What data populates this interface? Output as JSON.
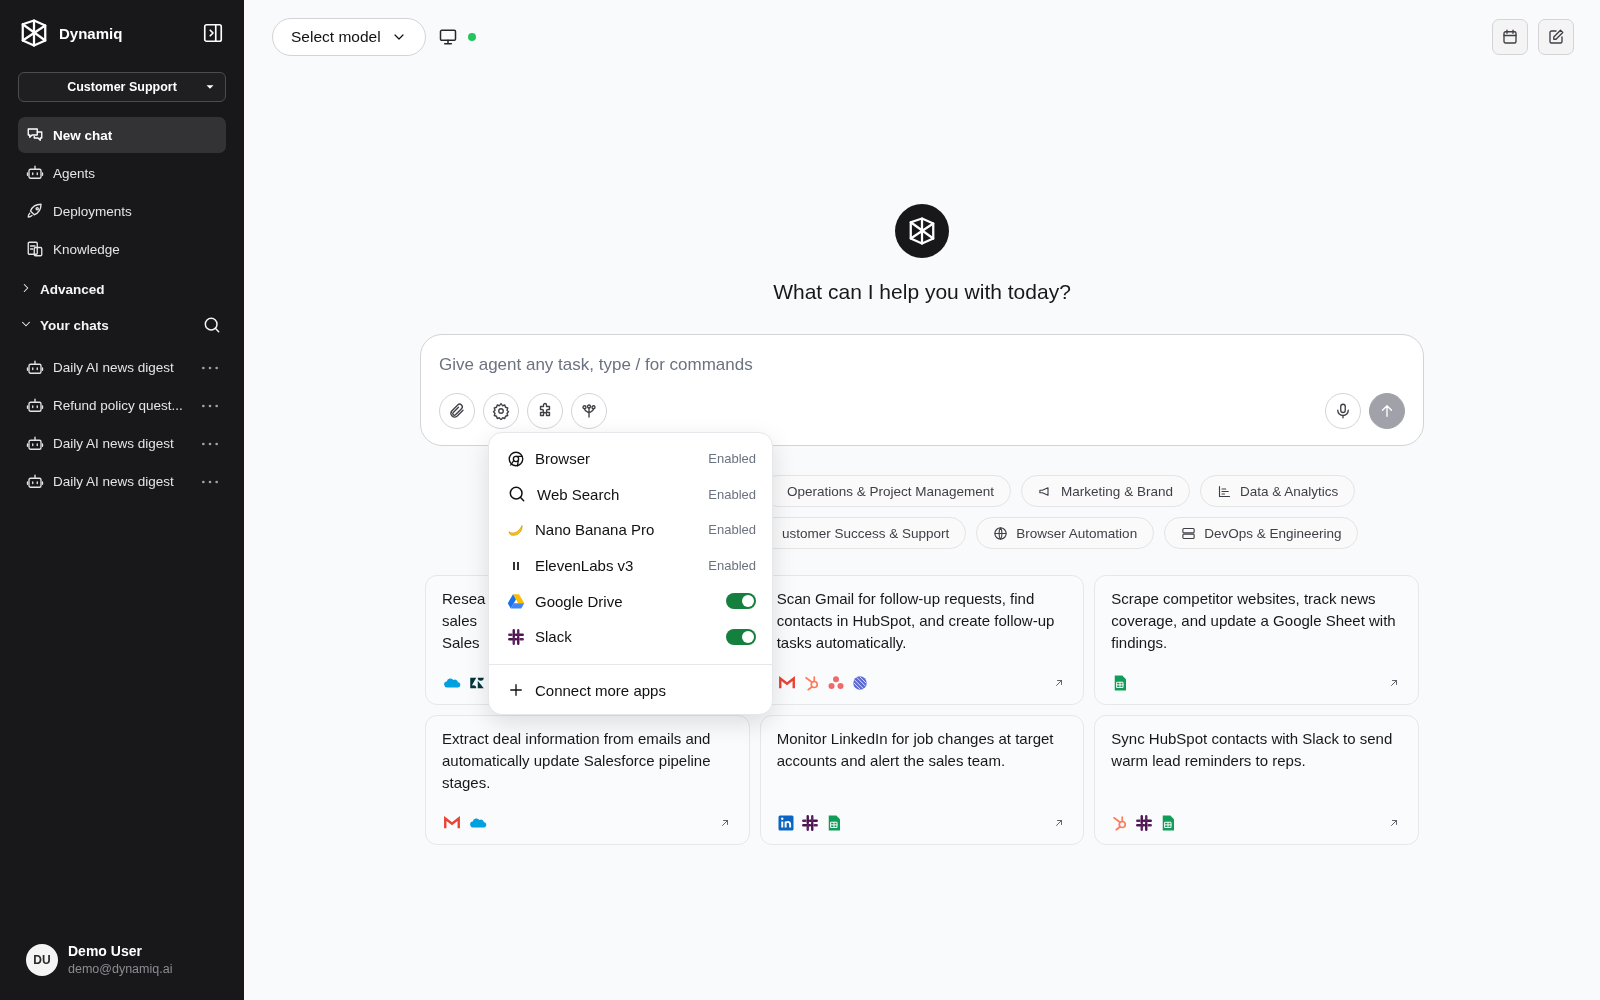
{
  "sidebar": {
    "brand": "Dynamiq",
    "workspace": "Customer Support",
    "nav": [
      {
        "label": "New chat",
        "selected": true
      },
      {
        "label": "Agents",
        "selected": false
      },
      {
        "label": "Deployments",
        "selected": false
      },
      {
        "label": "Knowledge",
        "selected": false
      }
    ],
    "sections": [
      {
        "label": "Advanced",
        "expanded": false
      },
      {
        "label": "Your chats",
        "expanded": true,
        "children": [
          {
            "label": "Daily AI news digest"
          },
          {
            "label": "Refund policy quest..."
          },
          {
            "label": "Daily AI news digest"
          },
          {
            "label": "Daily AI news digest"
          }
        ]
      }
    ],
    "user": {
      "initials": "DU",
      "name": "Demo User",
      "email": "demo@dynamiq.ai"
    }
  },
  "top_bar": {
    "model_select": "Select model"
  },
  "hero": {
    "title": "What can I help you with today?"
  },
  "composer": {
    "placeholder": "Give agent any task, type / for commands"
  },
  "tools_menu": {
    "items": [
      {
        "label": "Browser",
        "kind": "status",
        "status": "Enabled"
      },
      {
        "label": "Web Search",
        "kind": "status",
        "status": "Enabled"
      },
      {
        "label": "Nano Banana Pro",
        "kind": "status",
        "status": "Enabled"
      },
      {
        "label": "ElevenLabs v3",
        "kind": "status",
        "status": "Enabled"
      },
      {
        "label": "Google Drive",
        "kind": "toggle",
        "on": true
      },
      {
        "label": "Slack",
        "kind": "toggle",
        "on": true
      }
    ],
    "footer": "Connect more apps"
  },
  "chip_rows": [
    [
      {
        "label": "Operations & Project Management"
      },
      {
        "label": "Marketing & Brand"
      },
      {
        "label": "Data & Analytics"
      }
    ],
    [
      {
        "label": "ustomer Success & Support"
      },
      {
        "label": "Browser Automation"
      },
      {
        "label": "DevOps & Engineering"
      }
    ]
  ],
  "cards": [
    {
      "text": "Resea\nsales\nSales",
      "apps": [
        {
          "kind": "salesforce"
        },
        {
          "kind": "zendesk"
        }
      ]
    },
    {
      "text": "Scan Gmail for follow-up requests, find contacts in HubSpot, and create follow-up tasks automatically.",
      "apps": [
        {
          "kind": "gmail"
        },
        {
          "kind": "hubspot"
        },
        {
          "kind": "asana"
        },
        {
          "kind": "linear"
        }
      ]
    },
    {
      "text": "Scrape competitor websites, track news coverage, and update a Google Sheet with findings.",
      "apps": [
        {
          "kind": "sheets"
        }
      ]
    },
    {
      "text": "Extract deal information from emails and automatically update Salesforce pipeline stages.",
      "apps": [
        {
          "kind": "gmail"
        },
        {
          "kind": "salesforce"
        }
      ]
    },
    {
      "text": "Monitor LinkedIn for job changes at target accounts and alert the sales team.",
      "apps": [
        {
          "kind": "linkedin"
        },
        {
          "kind": "slack"
        },
        {
          "kind": "sheets"
        }
      ]
    },
    {
      "text": "Sync HubSpot contacts with Slack to send warm lead reminders to reps.",
      "apps": [
        {
          "kind": "hubspot"
        },
        {
          "kind": "slack"
        },
        {
          "kind": "sheets"
        }
      ]
    }
  ]
}
